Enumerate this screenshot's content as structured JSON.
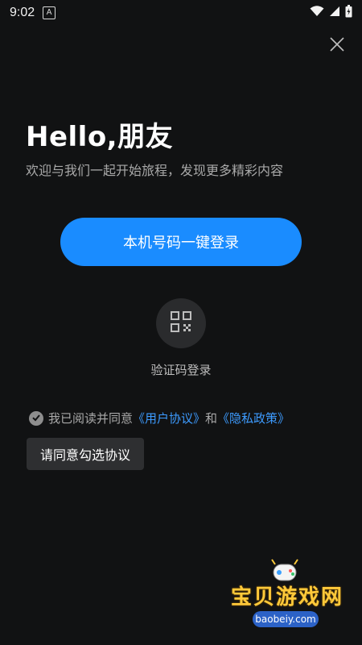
{
  "status_bar": {
    "time": "9:02",
    "notification_badge": "A",
    "icons": [
      "wifi-icon",
      "cellular-icon",
      "battery-icon"
    ]
  },
  "header": {
    "title": "Hello,朋友",
    "subtitle": "欢迎与我们一起开始旅程，发现更多精彩内容"
  },
  "actions": {
    "one_click_login": "本机号码一键登录",
    "verification_login": "验证码登录"
  },
  "agreement": {
    "prefix": "我已阅读并同意",
    "user_agreement": "《用户协议》",
    "conjunction": "和",
    "privacy_policy": "《隐私政策》",
    "tooltip": "请同意勾选协议"
  },
  "watermark": {
    "name": "宝贝游戏网",
    "url": "baobeiy.com"
  },
  "colors": {
    "background": "#111213",
    "accent": "#1a8cff",
    "link": "#3d9bff",
    "watermark_gold": "#ffc93a"
  }
}
